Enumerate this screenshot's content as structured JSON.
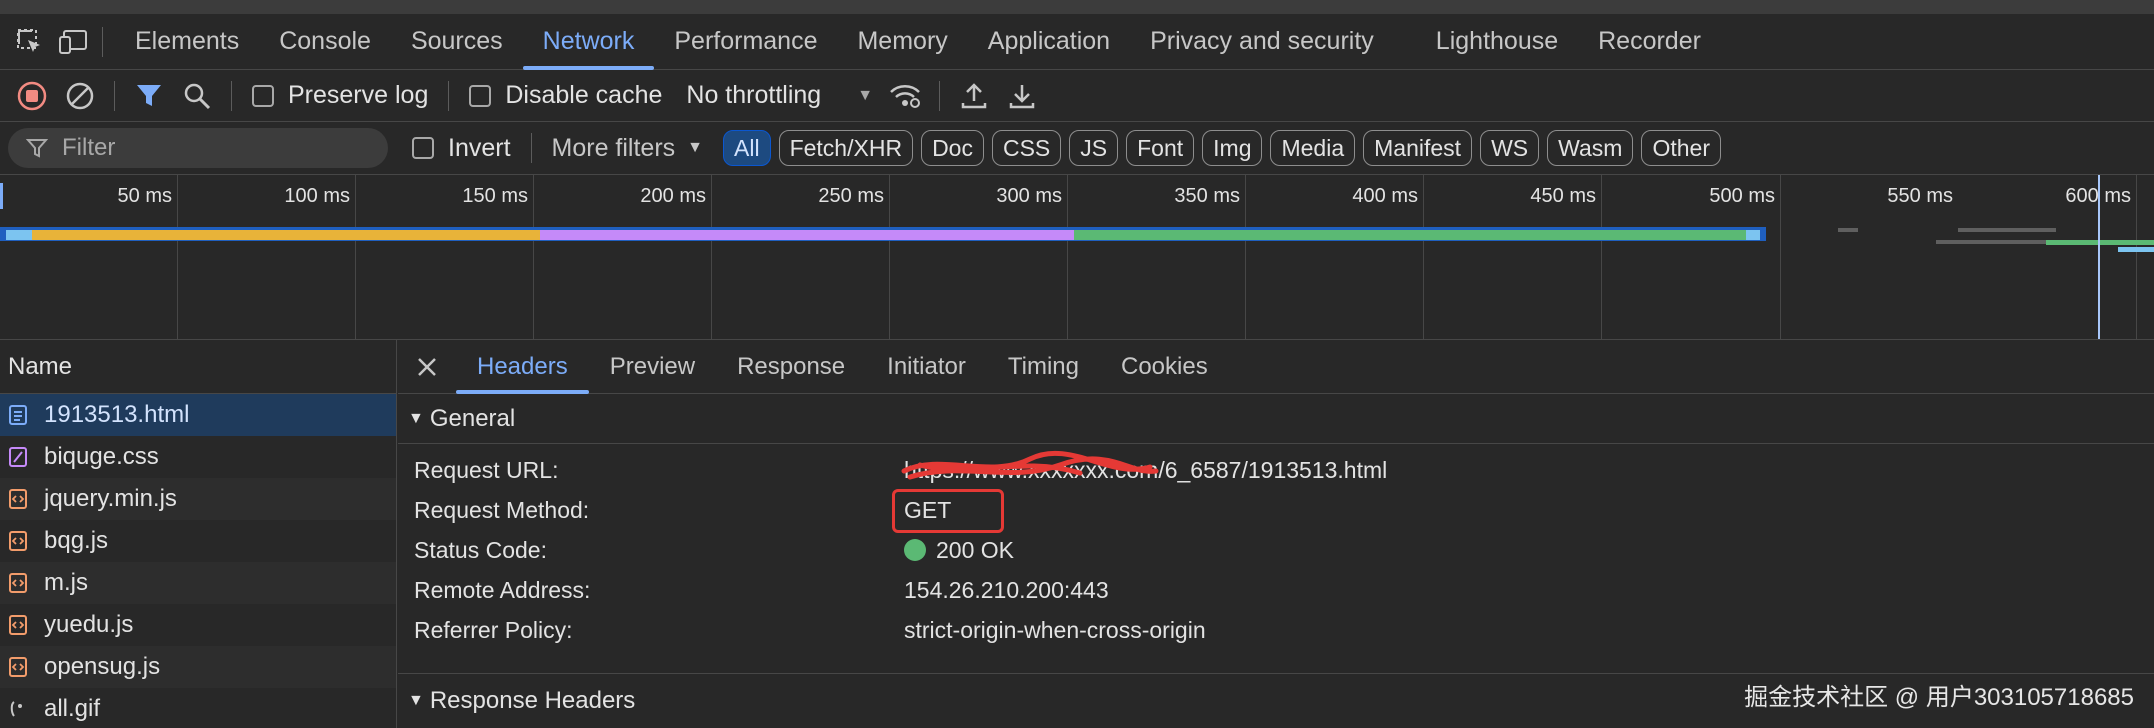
{
  "tabs": {
    "items": [
      "Elements",
      "Console",
      "Sources",
      "Network",
      "Performance",
      "Memory",
      "Application",
      "Privacy and security",
      "Lighthouse",
      "Recorder"
    ],
    "active": "Network"
  },
  "toolbar": {
    "preserve_log": "Preserve log",
    "disable_cache": "Disable cache",
    "throttling": "No throttling"
  },
  "filterbar": {
    "filter_placeholder": "Filter",
    "invert": "Invert",
    "more_filters": "More filters",
    "chips": [
      "All",
      "Fetch/XHR",
      "Doc",
      "CSS",
      "JS",
      "Font",
      "Img",
      "Media",
      "Manifest",
      "WS",
      "Wasm",
      "Other"
    ],
    "active_chip": "All"
  },
  "timeline": {
    "ticks": [
      "50 ms",
      "100 ms",
      "150 ms",
      "200 ms",
      "250 ms",
      "300 ms",
      "350 ms",
      "400 ms",
      "450 ms",
      "500 ms",
      "550 ms",
      "600 ms"
    ]
  },
  "request_list": {
    "header": "Name",
    "items": [
      {
        "name": "1913513.html",
        "type": "doc"
      },
      {
        "name": "biquge.css",
        "type": "css"
      },
      {
        "name": "jquery.min.js",
        "type": "js"
      },
      {
        "name": "bqg.js",
        "type": "js"
      },
      {
        "name": "m.js",
        "type": "js"
      },
      {
        "name": "yuedu.js",
        "type": "js"
      },
      {
        "name": "opensug.js",
        "type": "js"
      },
      {
        "name": "all.gif",
        "type": "img"
      }
    ]
  },
  "details": {
    "tabs": [
      "Headers",
      "Preview",
      "Response",
      "Initiator",
      "Timing",
      "Cookies"
    ],
    "active_tab": "Headers",
    "general_title": "General",
    "general": [
      {
        "key": "Request URL:",
        "value": "https://www.xxxxxxx.com/6_6587/1913513.html"
      },
      {
        "key": "Request Method:",
        "value": "GET"
      },
      {
        "key": "Status Code:",
        "value": "200 OK"
      },
      {
        "key": "Remote Address:",
        "value": "154.26.210.200:443"
      },
      {
        "key": "Referrer Policy:",
        "value": "strict-origin-when-cross-origin"
      }
    ],
    "response_headers_title": "Response Headers"
  },
  "watermark": "掘金技术社区 @ 用户303105718685",
  "colors": {
    "accent": "#7cacf8",
    "record_red": "#f28b82",
    "annotation_red": "#e53935",
    "status_green": "#5bb974"
  }
}
